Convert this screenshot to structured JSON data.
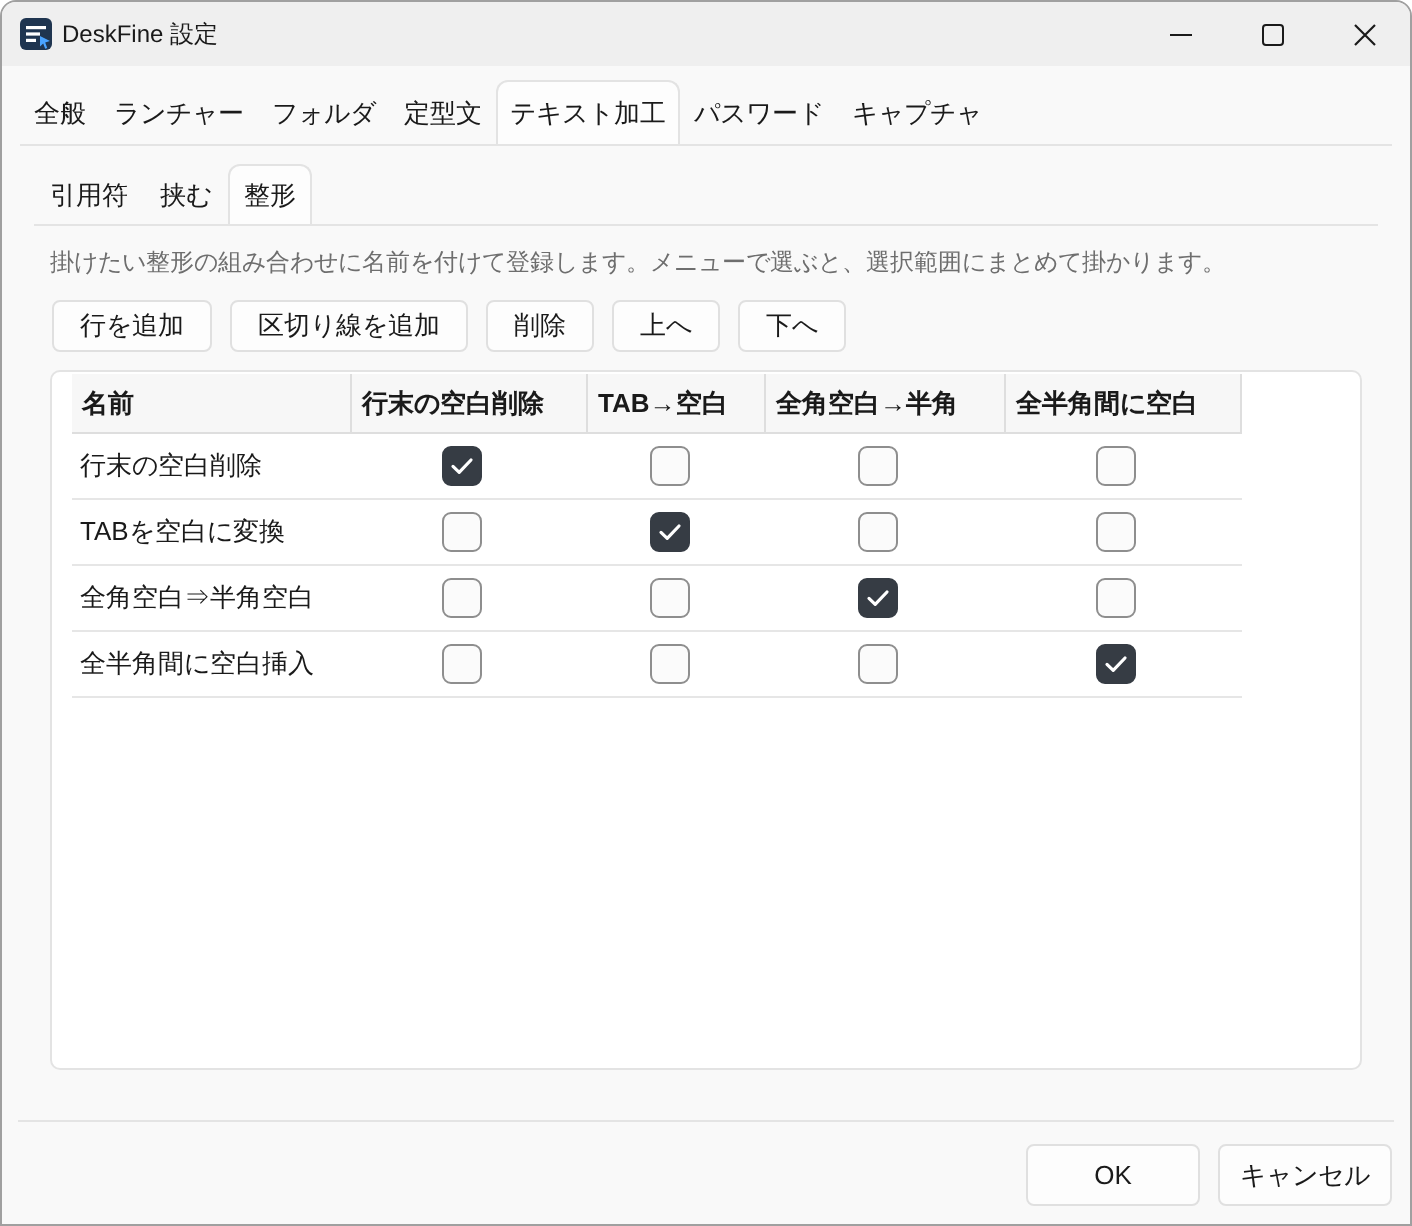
{
  "window": {
    "title": "DeskFine 設定"
  },
  "tabs": [
    {
      "label": "全般",
      "selected": false
    },
    {
      "label": "ランチャー",
      "selected": false
    },
    {
      "label": "フォルダ",
      "selected": false
    },
    {
      "label": "定型文",
      "selected": false
    },
    {
      "label": "テキスト加工",
      "selected": true
    },
    {
      "label": "パスワード",
      "selected": false
    },
    {
      "label": "キャプチャ",
      "selected": false
    }
  ],
  "subtabs": [
    {
      "label": "引用符",
      "selected": false
    },
    {
      "label": "挟む",
      "selected": false
    },
    {
      "label": "整形",
      "selected": true
    }
  ],
  "description": "掛けたい整形の組み合わせに名前を付けて登録します。メニューで選ぶと、選択範囲にまとめて掛かります。",
  "toolbar_buttons": [
    "行を追加",
    "区切り線を追加",
    "削除",
    "上へ",
    "下へ"
  ],
  "table": {
    "columns": [
      "名前",
      "行末の空白削除",
      "TAB→空白",
      "全角空白→半角",
      "全半角間に空白"
    ],
    "rows": [
      {
        "name": "行末の空白削除",
        "cells": [
          {
            "checked": true
          },
          {
            "checked": false
          },
          {
            "checked": false
          },
          {
            "checked": false
          }
        ]
      },
      {
        "name": "TABを空白に変換",
        "cells": [
          {
            "checked": false
          },
          {
            "checked": true
          },
          {
            "checked": false
          },
          {
            "checked": false
          }
        ]
      },
      {
        "name": "全角空白⇒半角空白",
        "cells": [
          {
            "checked": false
          },
          {
            "checked": false
          },
          {
            "checked": true
          },
          {
            "checked": false
          }
        ]
      },
      {
        "name": "全半角間に空白挿入",
        "cells": [
          {
            "checked": false
          },
          {
            "checked": false
          },
          {
            "checked": false
          },
          {
            "checked": true
          }
        ]
      }
    ]
  },
  "buttons": [
    "OK",
    "キャンセル"
  ]
}
